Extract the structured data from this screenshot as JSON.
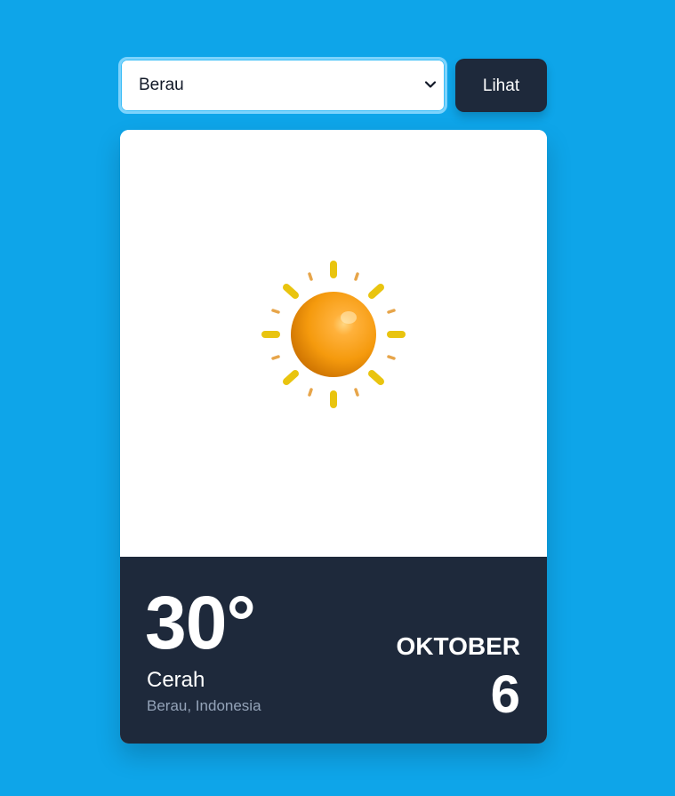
{
  "controls": {
    "location_select": {
      "selected": "Berau",
      "options": [
        "Berau"
      ]
    },
    "view_button_label": "Lihat"
  },
  "weather_card": {
    "icon": "sun-icon",
    "temperature": "30°",
    "condition": "Cerah",
    "location": "Berau, Indonesia",
    "month": "OKTOBER",
    "day": "6"
  },
  "colors": {
    "background": "#0ea5e9",
    "card_footer": "#1e293b",
    "button": "#1e293b",
    "select_border": "#7dd3fc",
    "muted_text": "#94a3b8"
  }
}
